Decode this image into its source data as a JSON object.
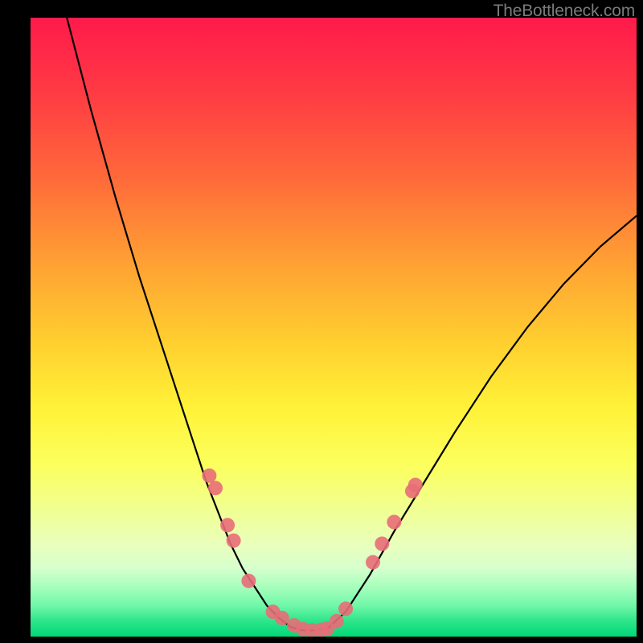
{
  "watermark": "TheBottleneck.com",
  "colors": {
    "frame": "#000000",
    "curve": "#000000",
    "dot": "#e86d78"
  },
  "chart_data": {
    "type": "line",
    "title": "",
    "xlabel": "",
    "ylabel": "",
    "xlim": [
      0,
      100
    ],
    "ylim": [
      0,
      100
    ],
    "legend": false,
    "grid": false,
    "axes_visible": false,
    "series": [
      {
        "name": "left-curve",
        "x": [
          6,
          10,
          14,
          18,
          22,
          25,
          27,
          29,
          31,
          33,
          35,
          37,
          39,
          41,
          43
        ],
        "y": [
          100,
          85,
          71,
          58,
          46,
          37,
          31,
          25,
          20,
          15,
          11,
          8,
          5,
          3,
          1.5
        ]
      },
      {
        "name": "valley-floor",
        "x": [
          43,
          45,
          47,
          49
        ],
        "y": [
          1.5,
          1,
          1,
          1.3
        ]
      },
      {
        "name": "right-curve",
        "x": [
          49,
          52,
          56,
          60,
          65,
          70,
          76,
          82,
          88,
          94,
          100
        ],
        "y": [
          1.3,
          4,
          10,
          17,
          25,
          33,
          42,
          50,
          57,
          63,
          68
        ]
      }
    ],
    "markers": [
      {
        "x": 29.5,
        "y": 26
      },
      {
        "x": 30.5,
        "y": 24
      },
      {
        "x": 32.5,
        "y": 18
      },
      {
        "x": 33.5,
        "y": 15.5
      },
      {
        "x": 36,
        "y": 9
      },
      {
        "x": 40,
        "y": 4
      },
      {
        "x": 41.5,
        "y": 3
      },
      {
        "x": 43.5,
        "y": 1.8
      },
      {
        "x": 45,
        "y": 1.2
      },
      {
        "x": 46.5,
        "y": 1.0
      },
      {
        "x": 48,
        "y": 1.1
      },
      {
        "x": 49,
        "y": 1.3
      },
      {
        "x": 50.5,
        "y": 2.5
      },
      {
        "x": 52,
        "y": 4.5
      },
      {
        "x": 56.5,
        "y": 12
      },
      {
        "x": 58,
        "y": 15
      },
      {
        "x": 60,
        "y": 18.5
      },
      {
        "x": 63,
        "y": 23.5
      },
      {
        "x": 63.5,
        "y": 24.5
      }
    ],
    "annotations": [],
    "description": "V-shaped bottleneck curve on rainbow background; minimum near x≈46; left branch steeper than right; salmon dots cluster along the lower portion of both branches."
  }
}
